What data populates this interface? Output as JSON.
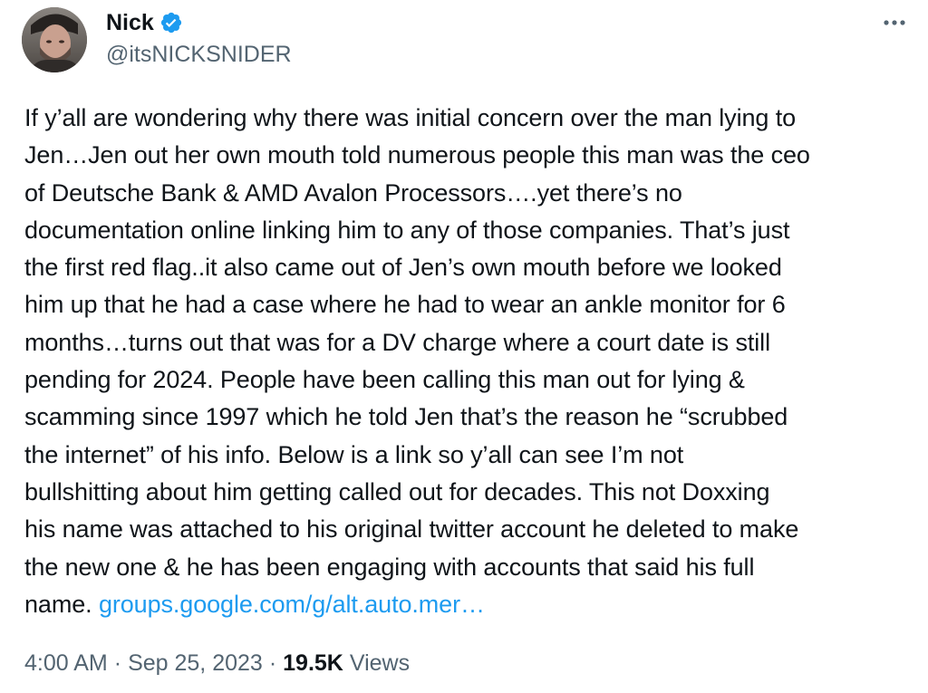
{
  "author": {
    "display_name": "Nick",
    "handle": "@itsNICKSNIDER",
    "verified": true,
    "avatar_icon": "profile-photo",
    "verified_icon": "verified-badge-icon",
    "verified_color": "#1d9bf0"
  },
  "menu": {
    "icon": "more-horizontal-icon"
  },
  "tweet": {
    "text": "If y’all are wondering why there was initial concern over the man lying to\nJen…Jen out her own mouth told numerous people this man was the ceo\nof Deutsche Bank & AMD Avalon Processors….yet there’s no\ndocumentation online linking him to any of those companies. That’s just\nthe first red flag..it also came out of Jen’s own mouth before we looked\nhim up that he had a case where he had to wear an ankle monitor for 6\nmonths…turns out that was for a DV charge where a court date is still\npending for 2024. People have been calling this man out for lying &\nscamming since 1997 which he told Jen that’s the reason he “scrubbed\nthe internet” of his info. Below is a link so y’all can see I’m not\nbullshitting about him getting called out for decades. This not Doxxing\nhis name was attached to his original twitter account he deleted to make\nthe new one & he has been engaging with accounts that said his full\nname. ",
    "link_text": "groups.google.com/g/alt.auto.mer…",
    "link_color": "#1d9bf0"
  },
  "meta": {
    "time": "4:00 AM",
    "separator": "·",
    "date": "Sep 25, 2023",
    "views_count": "19.5K",
    "views_label": "Views"
  }
}
